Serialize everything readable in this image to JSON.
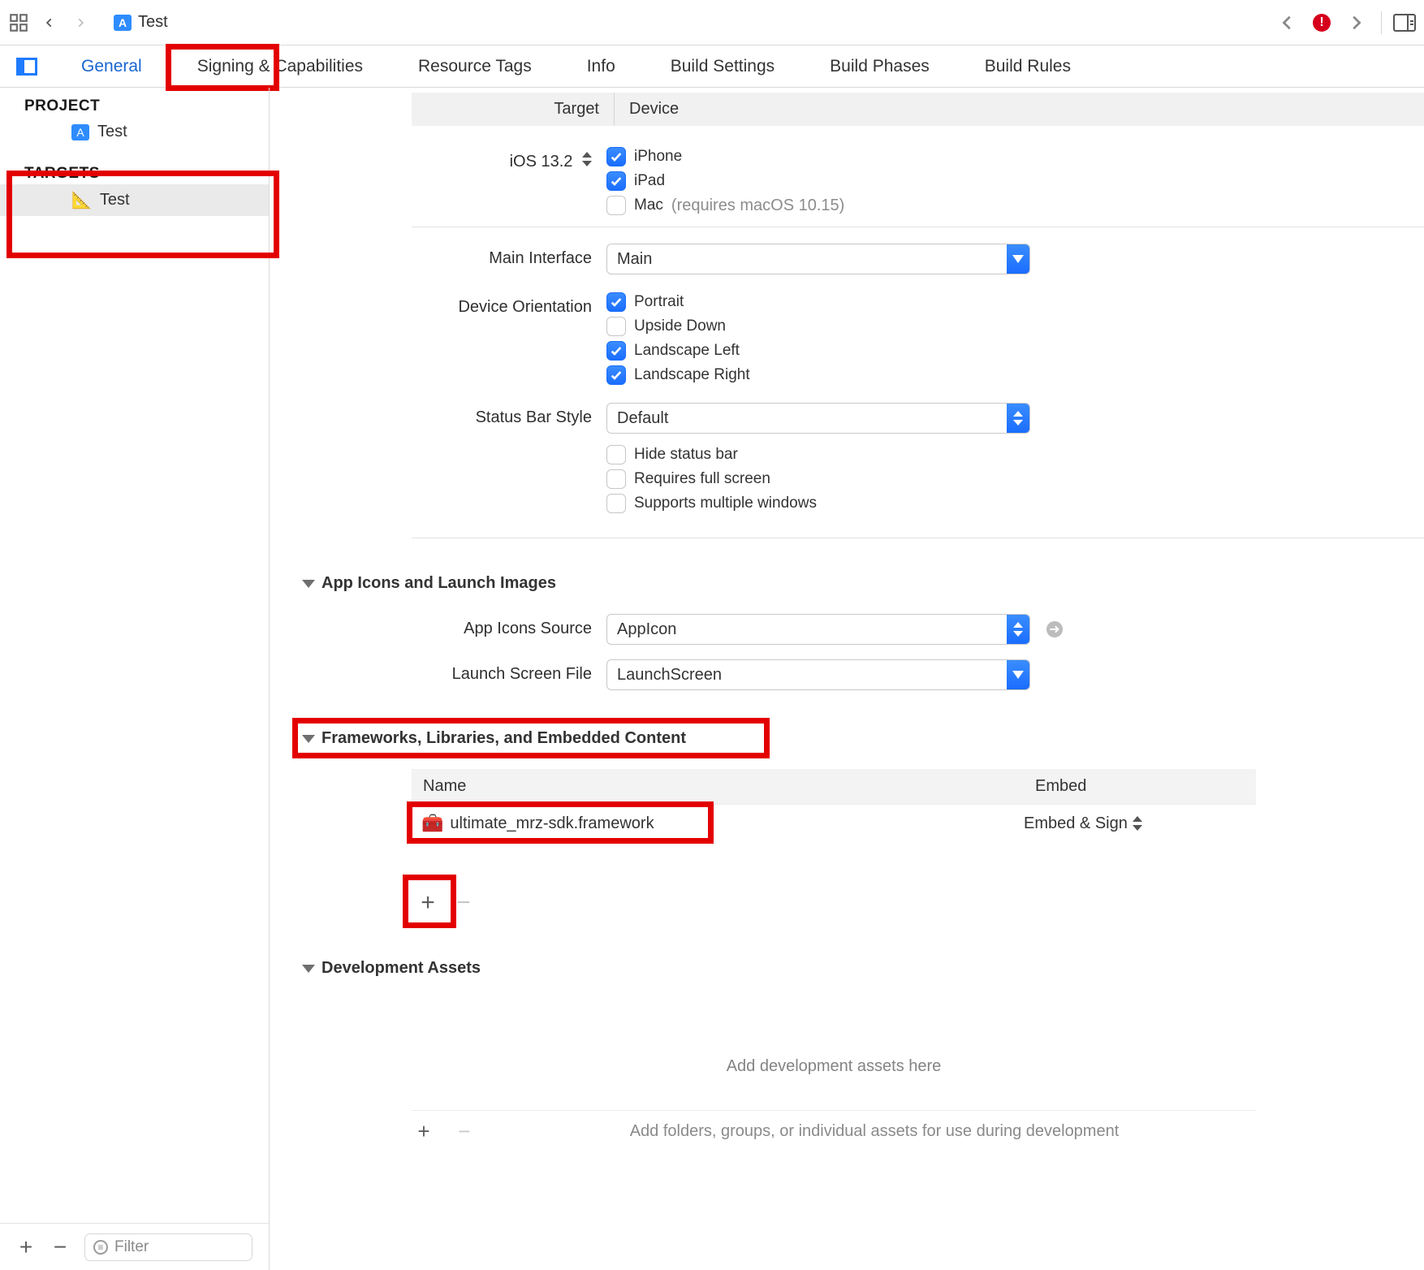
{
  "topbar": {
    "crumb": "Test",
    "error_count": "!"
  },
  "tabs": {
    "general": "General",
    "signing": "Signing & Capabilities",
    "resource": "Resource Tags",
    "info": "Info",
    "build_settings": "Build Settings",
    "build_phases": "Build Phases",
    "build_rules": "Build Rules"
  },
  "sidebar": {
    "project_header": "PROJECT",
    "project_item": "Test",
    "targets_header": "TARGETS",
    "target_item": "Test",
    "filter_placeholder": "Filter"
  },
  "content": {
    "hdr_target": "Target",
    "hdr_device": "Device",
    "ios_label": "iOS 13.2",
    "devices": {
      "iphone": "iPhone",
      "ipad": "iPad",
      "mac": "Mac",
      "mac_note": "(requires macOS 10.15)"
    },
    "main_iface_label": "Main Interface",
    "main_iface_value": "Main",
    "orient_label": "Device Orientation",
    "orients": {
      "portrait": "Portrait",
      "upside": "Upside Down",
      "land_left": "Landscape Left",
      "land_right": "Landscape Right"
    },
    "status_label": "Status Bar Style",
    "status_value": "Default",
    "status_opts": {
      "hide": "Hide status bar",
      "full": "Requires full screen",
      "multi": "Supports multiple windows"
    },
    "icons_section": "App Icons and Launch Images",
    "icons_source_label": "App Icons Source",
    "icons_source_value": "AppIcon",
    "launch_label": "Launch Screen File",
    "launch_value": "LaunchScreen",
    "fw_section": "Frameworks, Libraries, and Embedded Content",
    "fw_th_name": "Name",
    "fw_th_embed": "Embed",
    "fw_item": "ultimate_mrz-sdk.framework",
    "fw_embed": "Embed & Sign",
    "dev_section": "Development Assets",
    "dev_placeholder": "Add development assets here",
    "dev_hint": "Add folders, groups, or individual assets for use during development"
  }
}
